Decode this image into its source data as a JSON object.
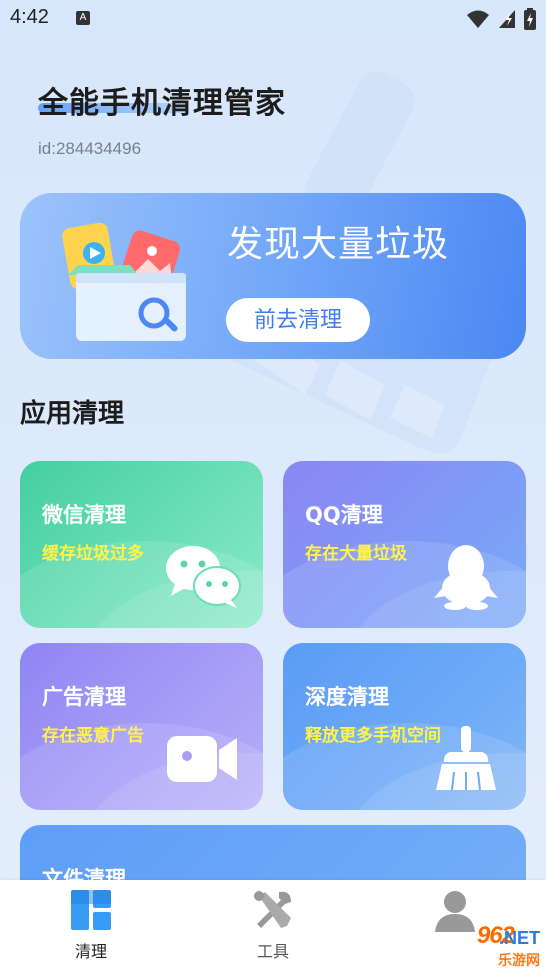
{
  "status_bar": {
    "time": "4:42",
    "app_icon_letter": "A"
  },
  "header": {
    "title": "全能手机清理管家",
    "user_id": "id:284434496"
  },
  "banner": {
    "title": "发现大量垃圾",
    "button_label": "前去清理"
  },
  "section": {
    "title": "应用清理"
  },
  "cards": [
    {
      "title": "微信清理",
      "subtitle": "缓存垃圾过多",
      "icon": "wechat-icon"
    },
    {
      "title": "QQ清理",
      "subtitle": "存在大量垃圾",
      "icon": "qq-penguin-icon"
    },
    {
      "title": "广告清理",
      "subtitle": "存在恶意广告",
      "icon": "video-camera-icon"
    },
    {
      "title": "深度清理",
      "subtitle": "释放更多手机空间",
      "icon": "broom-icon"
    },
    {
      "title": "文件清理",
      "subtitle": "",
      "icon": ""
    }
  ],
  "bottom_nav": [
    {
      "label": "清理",
      "icon": "grid-icon",
      "active": true
    },
    {
      "label": "工具",
      "icon": "tools-icon",
      "active": false
    },
    {
      "label": "",
      "icon": "user-icon",
      "active": false
    }
  ],
  "watermark": {
    "number": "962",
    "suffix": ".NET",
    "text": "乐游网"
  },
  "colors": {
    "accent": "#4c87f3",
    "highlight_text": "#fff34a",
    "wechat": "#44cea0",
    "qq": "#8c86f3"
  }
}
